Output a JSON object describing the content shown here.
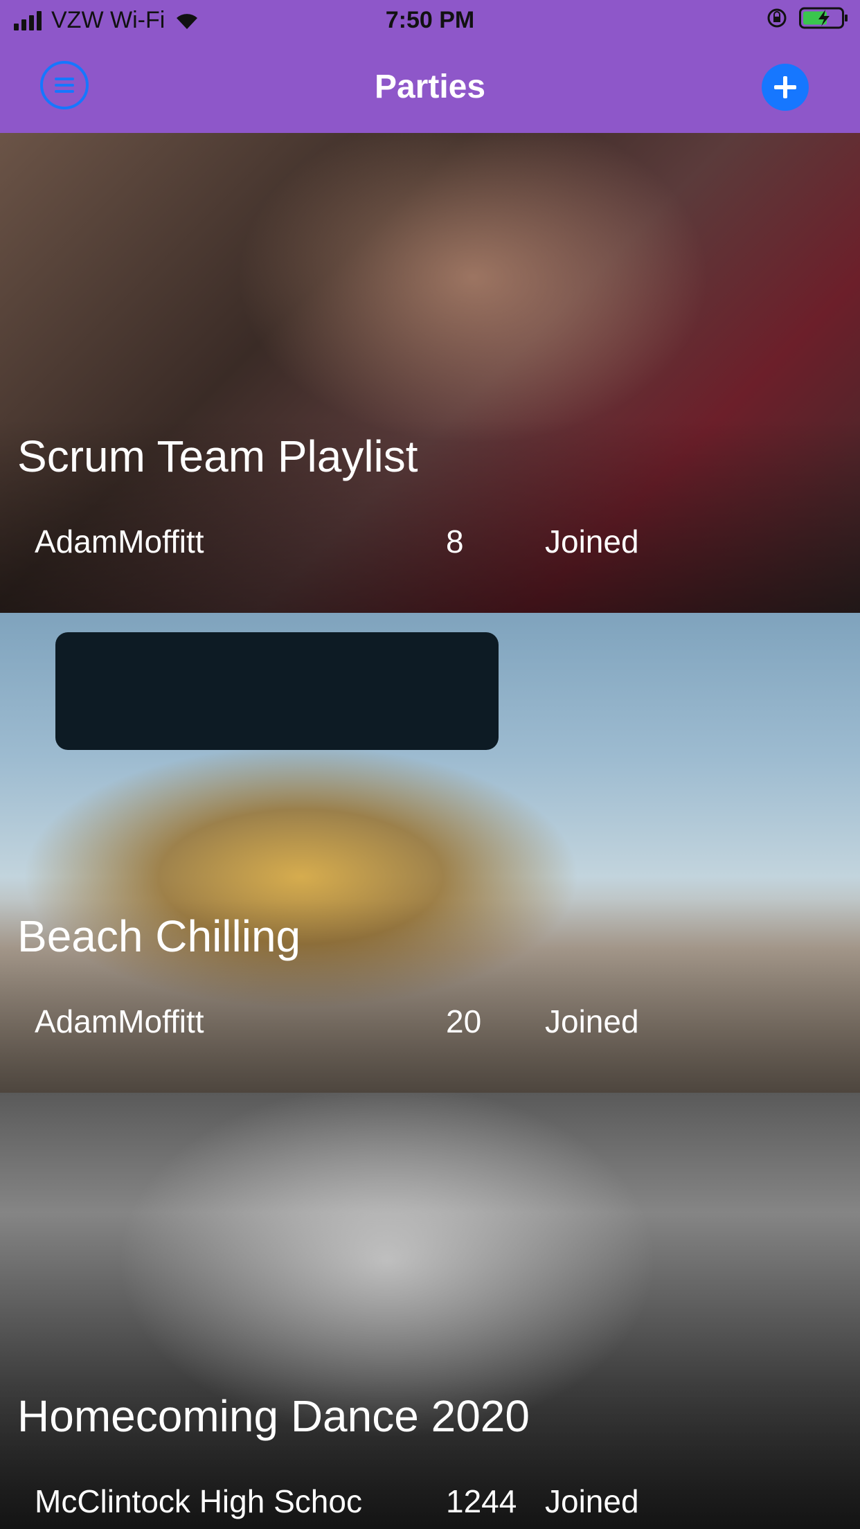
{
  "status_bar": {
    "carrier": "VZW Wi-Fi",
    "time": "7:50 PM"
  },
  "header": {
    "title": "Parties",
    "menu_icon": "menu-circle-icon",
    "add_icon": "plus-circle-icon",
    "background_color": "#8e57c9",
    "accent_color": "#1677ff"
  },
  "parties": [
    {
      "name": "Scrum Team Playlist",
      "host": "AdamMoffitt",
      "count": "8",
      "status": "Joined"
    },
    {
      "name": "Beach Chilling",
      "host": "AdamMoffitt",
      "count": "20",
      "status": "Joined"
    },
    {
      "name": "Homecoming Dance 2020",
      "host": "McClintock High Schoc",
      "count": "1244",
      "status": "Joined"
    }
  ]
}
